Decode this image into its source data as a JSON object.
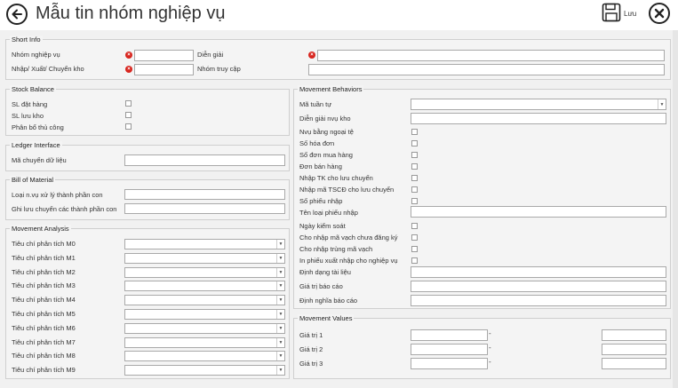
{
  "header": {
    "title": "Mẫu tin nhóm nghiệp vụ",
    "save_label": "Lưu"
  },
  "short_info": {
    "title": "Short Info",
    "nhom_nghiep_vu": "Nhóm nghiệp vụ",
    "dien_giai": "Diễn giải",
    "nhap_xuat": "Nhập/ Xuất/ Chuyển kho",
    "nhom_truy_cap": "Nhóm truy cập"
  },
  "stock_balance": {
    "title": "Stock Balance",
    "items": [
      "SL đặt hàng",
      "SL lưu kho",
      "Phân bổ thủ công"
    ]
  },
  "ledger": {
    "title": "Ledger Interface",
    "label": "Mã chuyển dữ liệu"
  },
  "bom": {
    "title": "Bill of Material",
    "items": [
      "Loại n.vụ xử lý thành phần con",
      "Ghi lưu chuyển các thành phần con"
    ]
  },
  "movement_analysis": {
    "title": "Movement Analysis",
    "items": [
      "Tiêu chí phân tích M0",
      "Tiêu chí phân tích M1",
      "Tiêu chí phân tích M2",
      "Tiêu chí phân tích M3",
      "Tiêu chí phân tích M4",
      "Tiêu chí phân tích M5",
      "Tiêu chí phân tích M6",
      "Tiêu chí phân tích M7",
      "Tiêu chí phân tích M8",
      "Tiêu chí phân tích M9"
    ]
  },
  "behaviors": {
    "title": "Movement Behaviors",
    "ma_tuan_tu": "Mã tuần tự",
    "dien_giai_nvu": "Diễn giải nvụ kho",
    "checks": [
      "Nvụ bằng ngoại tệ",
      "Số hóa đơn",
      "Số đơn mua hàng",
      "Đơn bán hàng",
      "Nhập TK cho lưu chuyển",
      "Nhập mã TSCĐ cho lưu chuyển",
      "Số phiếu nhập"
    ],
    "ten_loai": "Tên loại phiếu nhập",
    "checks2": [
      "Ngày kiểm soát",
      "Cho nhập mã vạch chưa đăng ký",
      "Cho nhập trùng mã vạch",
      "In phiếu xuất nhập cho nghiệp vụ"
    ],
    "inputs2": [
      "Định dạng tài liệu",
      "Giá trị báo cáo",
      "Định nghĩa báo cáo"
    ]
  },
  "movement_values": {
    "title": "Movement Values",
    "items": [
      "Giá trị 1",
      "Giá trị 2",
      "Giá trị 3"
    ],
    "sep": "-"
  }
}
